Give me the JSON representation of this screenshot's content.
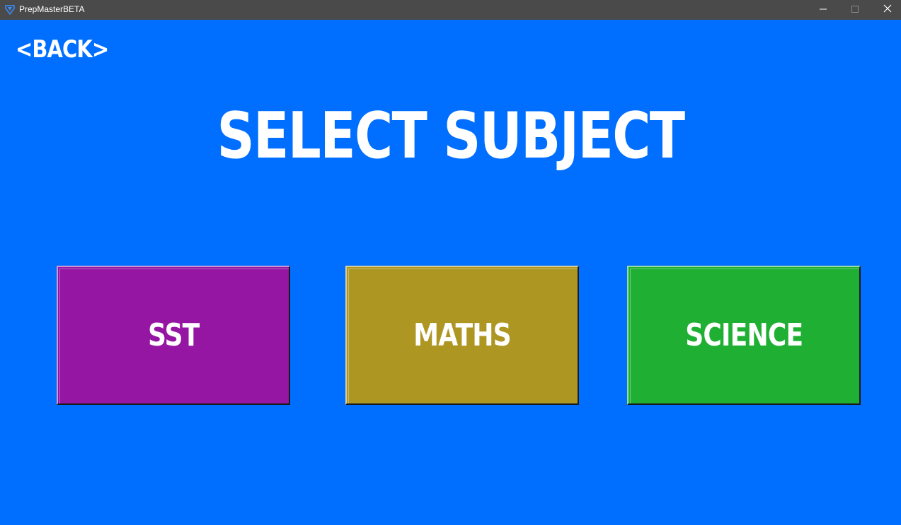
{
  "window": {
    "title": "PrepMasterBETA",
    "icon": "prepmaster-app-icon",
    "controls": {
      "minimize_icon": "minimize-icon",
      "maximize_icon": "maximize-icon",
      "close_icon": "close-icon"
    }
  },
  "colors": {
    "background": "#006EFF",
    "titlebar": "#4a4a4a",
    "text": "#FFFFFF",
    "sst": "#9516A3",
    "maths": "#AD9622",
    "science": "#1FB033"
  },
  "nav": {
    "back_label": "<BACK>"
  },
  "header": {
    "title": "SELECT SUBJECT"
  },
  "subjects": [
    {
      "label": "SST"
    },
    {
      "label": "MATHS"
    },
    {
      "label": "SCIENCE"
    }
  ]
}
